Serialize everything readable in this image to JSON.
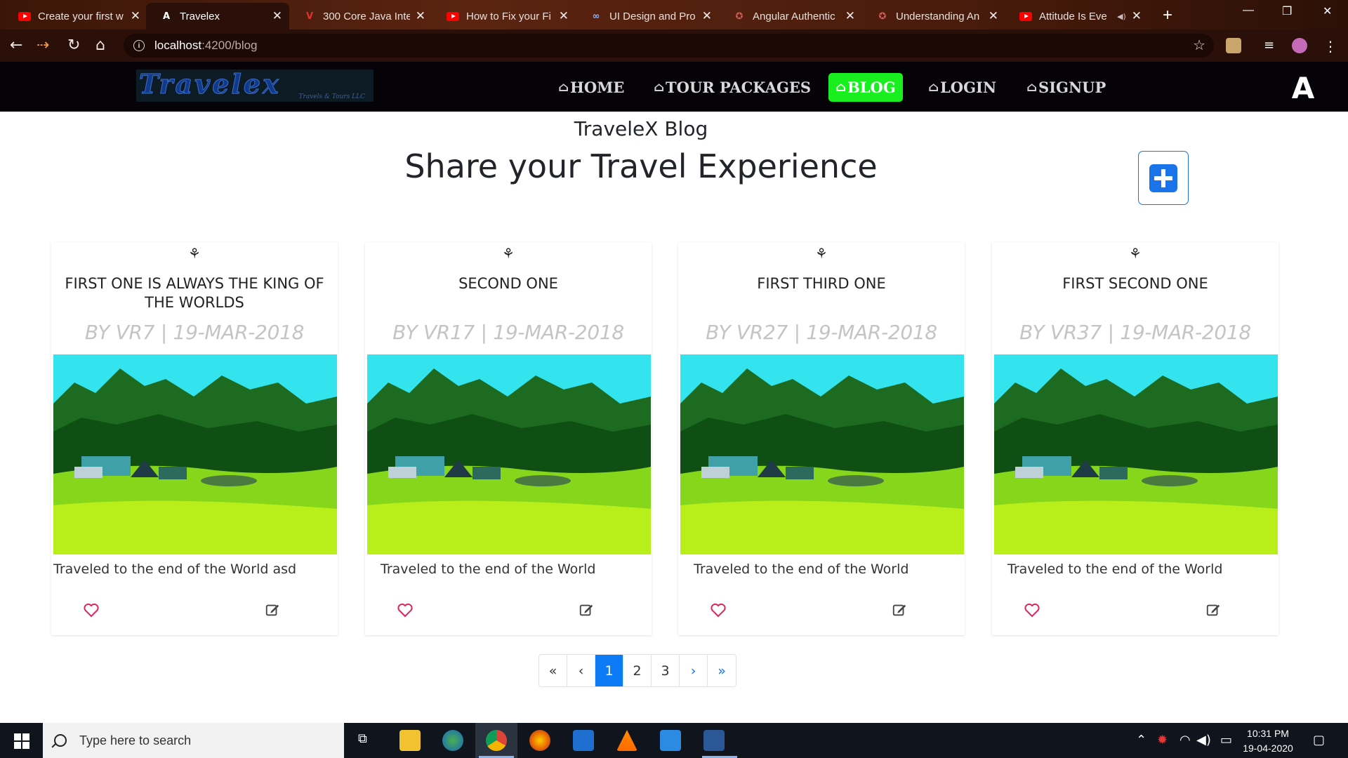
{
  "browser": {
    "tabs": [
      {
        "title": "Create your first w",
        "icon": "youtube-icon"
      },
      {
        "title": "Travelex",
        "icon": "angular-icon",
        "active": true
      },
      {
        "title": "300 Core Java Inte",
        "icon": "v-logo-icon"
      },
      {
        "title": "How to Fix your Fi",
        "icon": "youtube-icon"
      },
      {
        "title": "UI Design and Pro",
        "icon": "infinity-icon"
      },
      {
        "title": "Angular Authentic",
        "icon": "web-icon"
      },
      {
        "title": "Understanding An",
        "icon": "web-icon"
      },
      {
        "title": "Attitude Is Eve",
        "icon": "youtube-icon"
      }
    ],
    "url_host": "localhost",
    "url_path": ":4200/blog"
  },
  "nav": {
    "logo_text": "Travelex",
    "logo_tagline": "Travels & Tours LLC",
    "items": [
      "HOME",
      "TOUR PACKAGES",
      "BLOG",
      "LOGIN",
      "SIGNUP"
    ],
    "active": "BLOG",
    "avatar_letter": "A"
  },
  "page": {
    "title": "TraveleX Blog",
    "subtitle": "Share your Travel Experience"
  },
  "posts": [
    {
      "title": "FIRST ONE IS ALWAYS THE KING OF THE WORLDS",
      "byline": "BY VR7 | 19-MAR-2018",
      "description": "Traveled to the end of the World asd"
    },
    {
      "title": "SECOND ONE",
      "byline": "BY VR17 | 19-MAR-2018",
      "description": "Traveled to the end of the World"
    },
    {
      "title": "FIRST THIRD ONE",
      "byline": "BY VR27 | 19-MAR-2018",
      "description": "Traveled to the end of the World"
    },
    {
      "title": "FIRST SECOND ONE",
      "byline": "BY VR37 | 19-MAR-2018",
      "description": "Traveled to the end of the World"
    }
  ],
  "pagination": {
    "first": "«",
    "prev": "‹",
    "pages": [
      "1",
      "2",
      "3"
    ],
    "current": "1",
    "next": "›",
    "last": "»"
  },
  "taskbar": {
    "search_placeholder": "Type here to search",
    "time": "10:31 PM",
    "date": "19-04-2020"
  },
  "colors": {
    "nav_bg": "#050307",
    "active_nav": "#19ee1f",
    "primary": "#0d7bf5",
    "heart": "#e0245e"
  }
}
